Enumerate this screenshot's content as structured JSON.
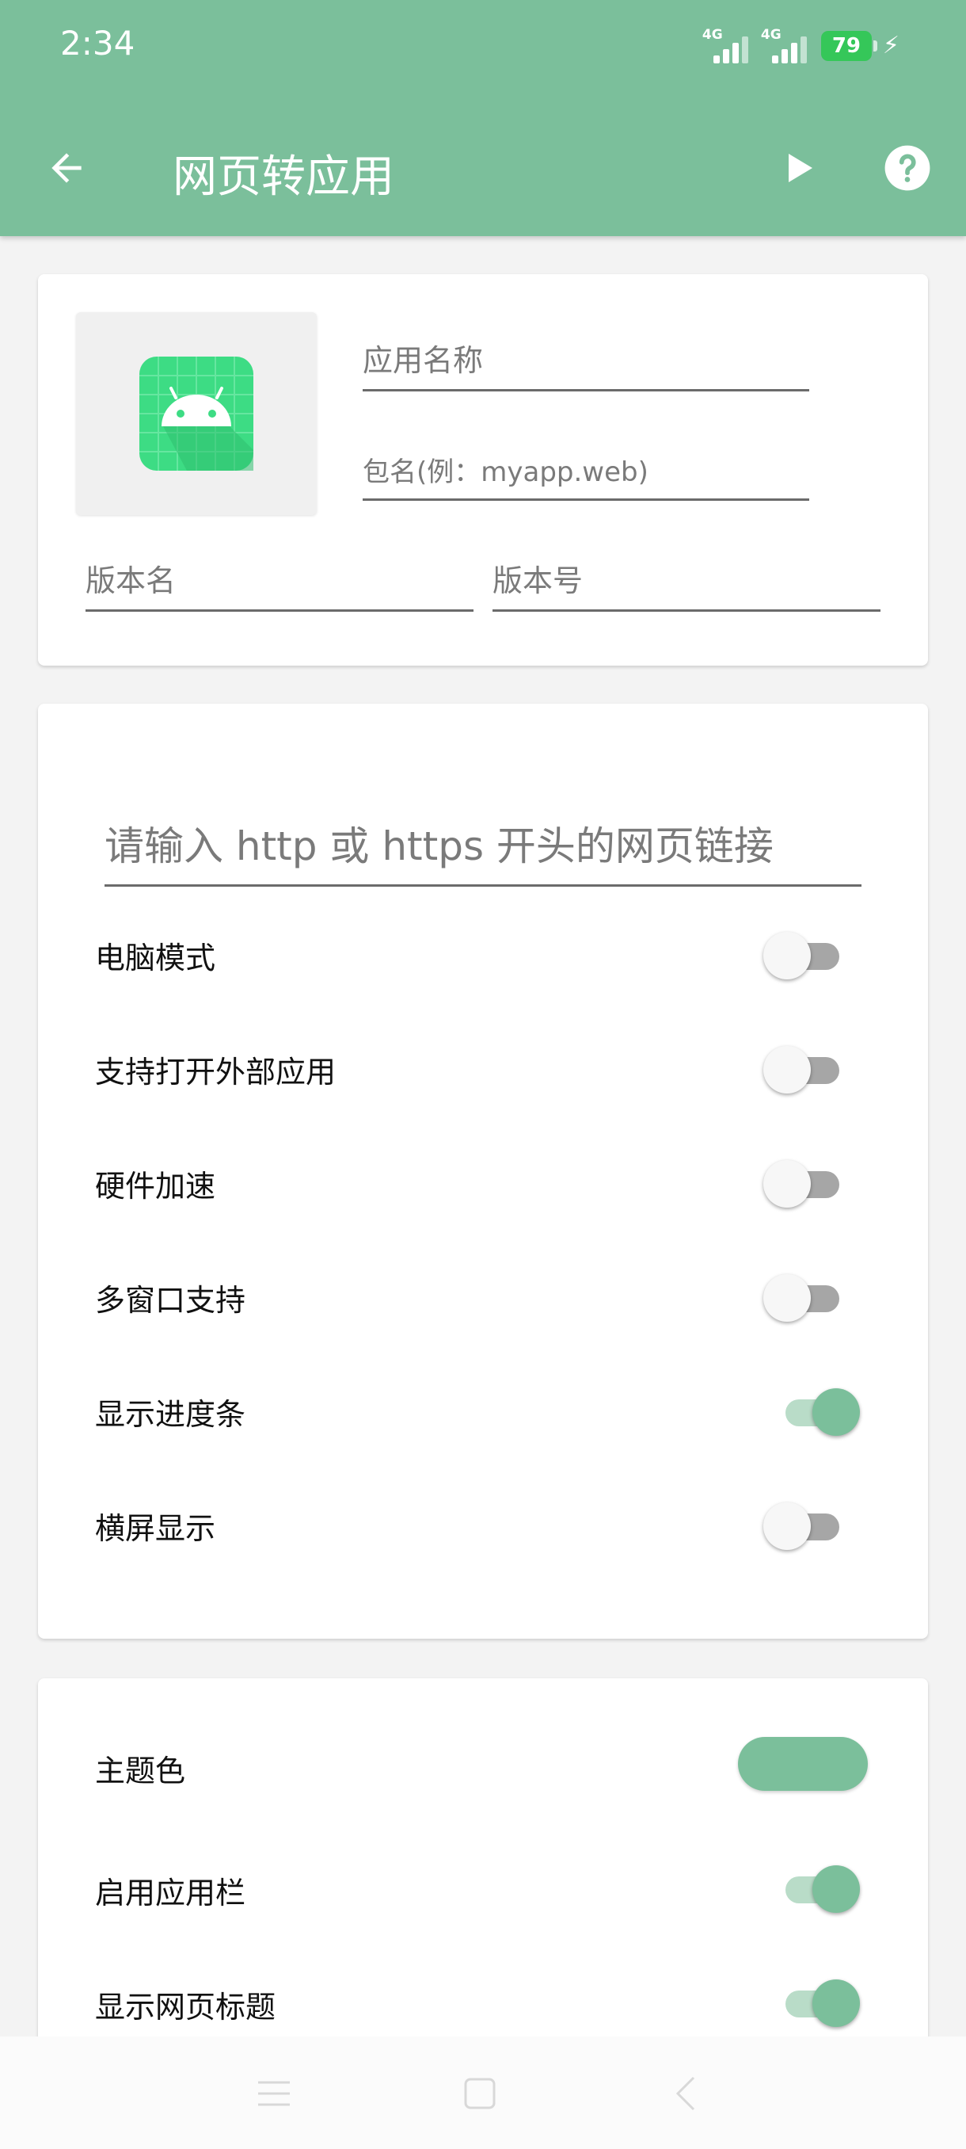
{
  "status_bar": {
    "time": "2:34",
    "network_1": "4G",
    "network_2": "4G",
    "battery": "79"
  },
  "toolbar": {
    "title": "网页转应用",
    "back_icon": "arrow-left-icon",
    "play_icon": "play-icon",
    "help_icon": "help-circle-icon"
  },
  "app_info": {
    "icon": "android-icon",
    "name_placeholder": "应用名称",
    "package_placeholder": "包名(例：myapp.web)",
    "version_name_placeholder": "版本名",
    "version_code_placeholder": "版本号"
  },
  "web_settings": {
    "url_placeholder": "请输入 http 或 https 开头的网页链接",
    "options": [
      {
        "label": "电脑模式",
        "on": false
      },
      {
        "label": "支持打开外部应用",
        "on": false
      },
      {
        "label": "硬件加速",
        "on": false
      },
      {
        "label": "多窗口支持",
        "on": false
      },
      {
        "label": "显示进度条",
        "on": true
      },
      {
        "label": "横屏显示",
        "on": false
      }
    ]
  },
  "appearance": {
    "theme_color_label": "主题色",
    "theme_color": "#7bbf9b",
    "options": [
      {
        "label": "启用应用栏",
        "on": true
      },
      {
        "label": "显示网页标题",
        "on": true
      }
    ]
  },
  "colors": {
    "accent": "#7bbf9b",
    "battery": "#35c759"
  }
}
